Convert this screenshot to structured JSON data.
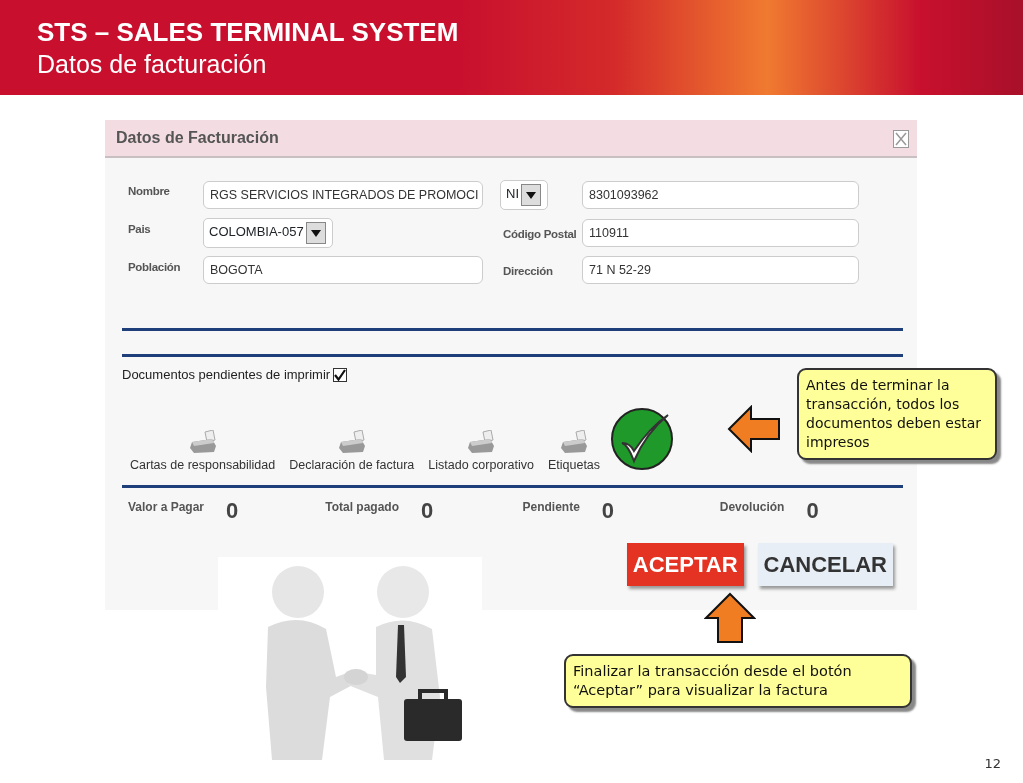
{
  "slide": {
    "title": "STS – SALES  TERMINAL SYSTEM",
    "subtitle": "Datos de facturación",
    "page_number": "12"
  },
  "dialog": {
    "title": "Datos de Facturación",
    "rows": [
      {
        "label": "Nombre",
        "value": "RGS SERVICIOS INTEGRADOS DE PROMOCI",
        "select": "NI",
        "value2": "8301093962"
      },
      {
        "label": "Pais",
        "select": "COLOMBIA-057",
        "label2": "Código Postal",
        "value2": "110911"
      },
      {
        "label": "Población",
        "value": "BOGOTA",
        "label2": "Dirección",
        "value2": "71 N 52-29"
      }
    ],
    "pending": {
      "label": "Documentos pendientes de imprimir",
      "checked": true
    },
    "documents": [
      "Cartas de responsabilidad",
      "Declaración de factura",
      "Listado corporativo",
      "Etiquetas"
    ],
    "totals": [
      {
        "label": "Valor a Pagar",
        "value": "0"
      },
      {
        "label": "Total pagado",
        "value": "0"
      },
      {
        "label": "Pendiente",
        "value": "0"
      },
      {
        "label": "Devolución",
        "value": "0"
      }
    ],
    "buttons": [
      {
        "label": "ACEPTAR",
        "kind": "primary"
      },
      {
        "label": "CANCELAR",
        "kind": "secondary"
      }
    ]
  },
  "callouts": [
    {
      "text": "Antes de terminar la transacción, todos los documentos deben estar impresos"
    },
    {
      "text": "Finalizar la transacción desde el botón “Aceptar” para visualizar la factura"
    }
  ]
}
